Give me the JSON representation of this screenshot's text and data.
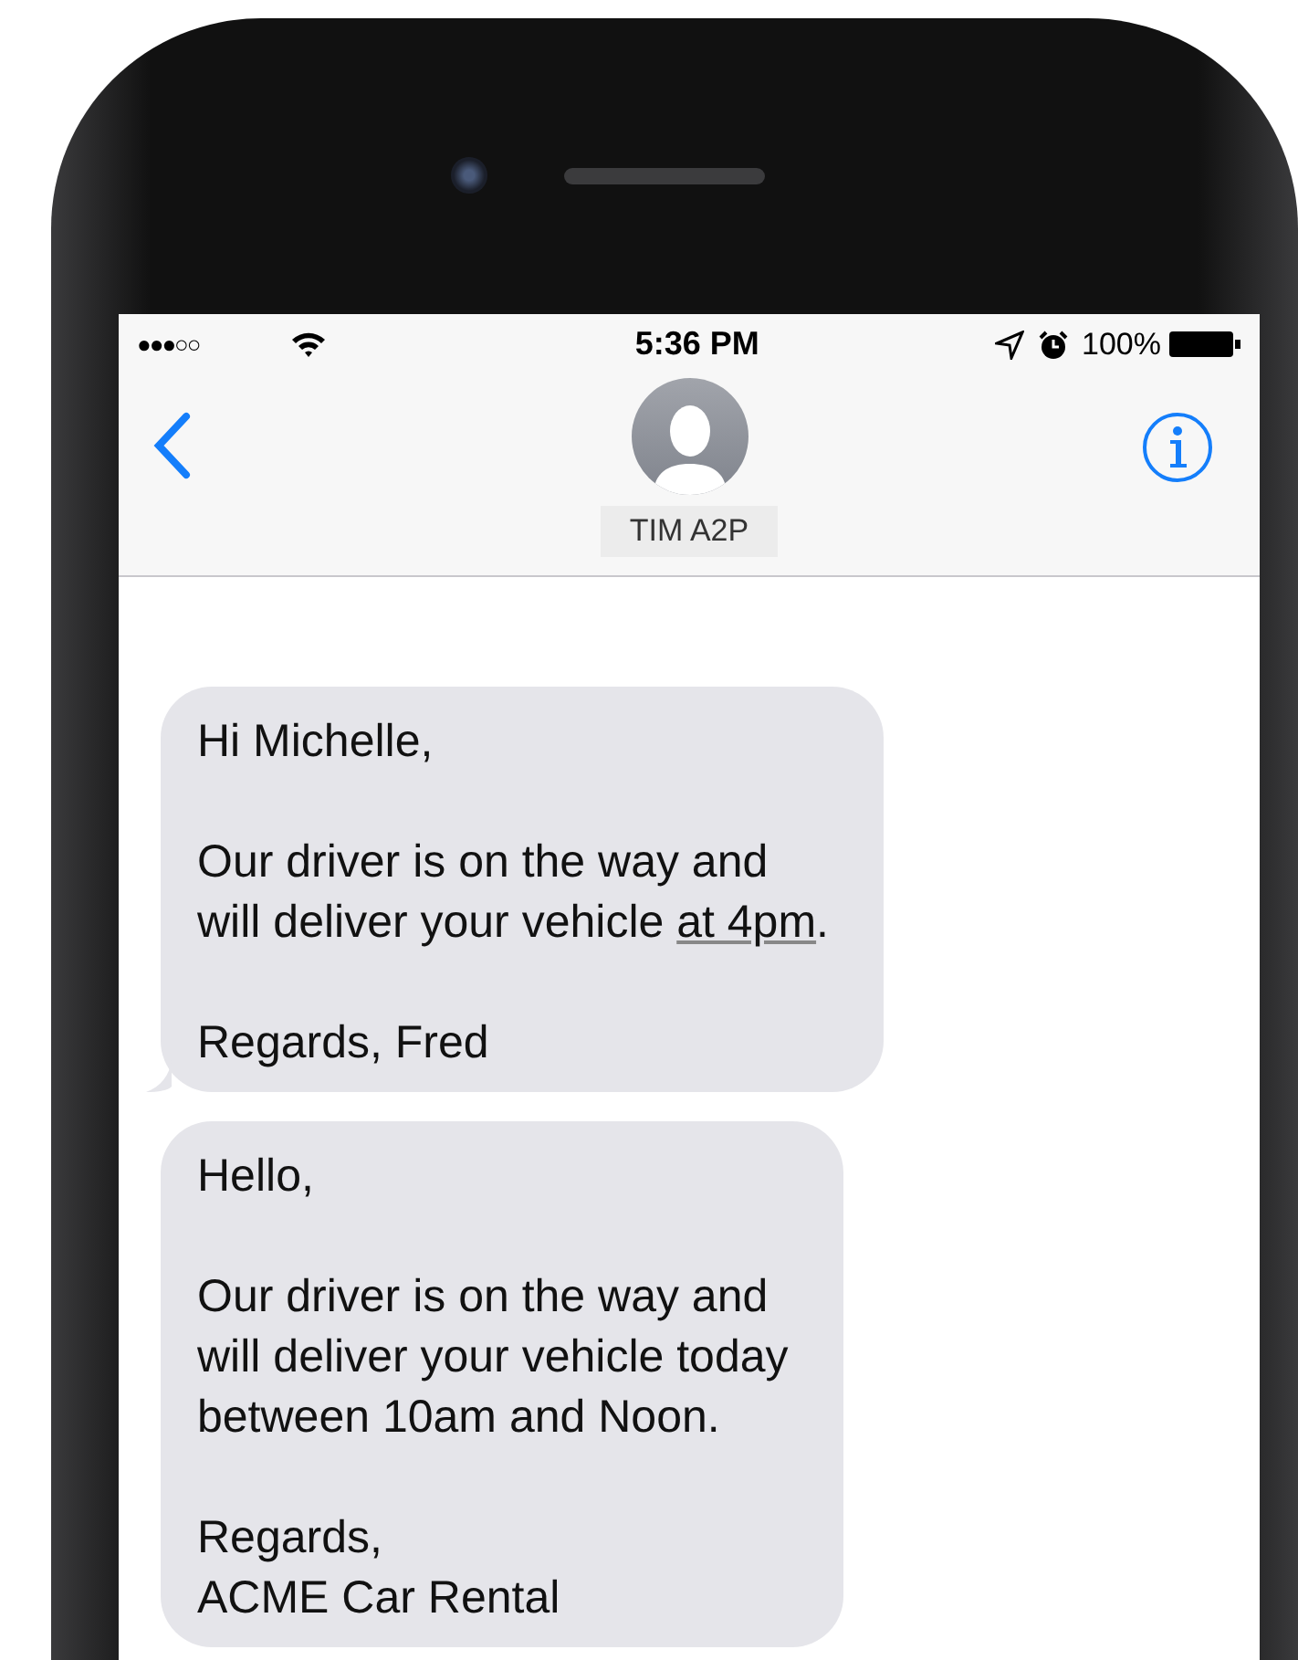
{
  "status_bar": {
    "carrier_signal": "●●●○○",
    "time": "5:36 PM",
    "battery": "100%"
  },
  "nav_bar": {
    "contact_name": "TIM A2P"
  },
  "messages": [
    {
      "tail": true,
      "paragraphs": [
        [
          {
            "text": "Hi Michelle,"
          }
        ],
        [
          {
            "text": "Our driver is on the way and\nwill deliver your vehicle "
          },
          {
            "text": "at 4pm",
            "kind": "detected"
          },
          {
            "text": "."
          }
        ],
        [
          {
            "text": "Regards, Fred"
          }
        ]
      ]
    },
    {
      "tail": false,
      "paragraphs": [
        [
          {
            "text": "Hello,"
          }
        ],
        [
          {
            "text": "Our driver is on the way and\nwill deliver your vehicle today\nbetween 10am and Noon."
          }
        ],
        [
          {
            "text": "Regards,\nACME Car Rental"
          }
        ]
      ]
    }
  ]
}
